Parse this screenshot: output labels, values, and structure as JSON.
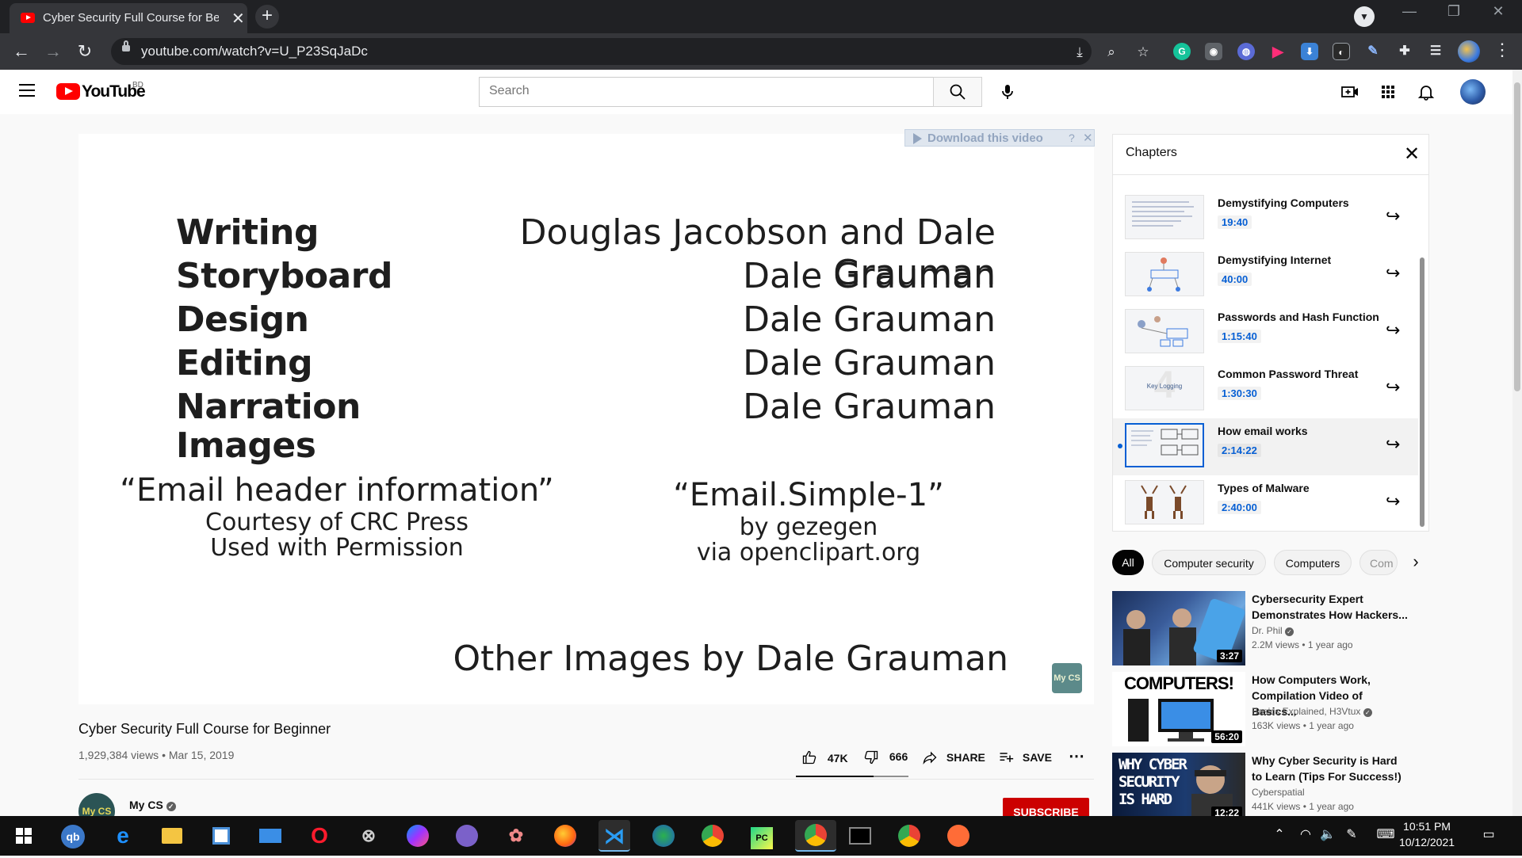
{
  "browser": {
    "tab_title": "Cyber Security Full Course for Beginner",
    "tab_close": "✕",
    "new_tab": "+",
    "url": "youtube.com/watch?v=U_P23SqJaDc",
    "win_min": "—",
    "win_max": "❐",
    "win_close": "✕"
  },
  "youtube": {
    "logo_text": "YouTube",
    "country": "BD",
    "search_placeholder": "Search"
  },
  "video": {
    "download_label": "Download this video",
    "download_help": "?",
    "download_close": "✕",
    "credits": [
      {
        "role": "Writing",
        "name": "Douglas Jacobson and Dale Grauman"
      },
      {
        "role": "Storyboard",
        "name": "Dale Grauman"
      },
      {
        "role": "Design",
        "name": "Dale Grauman"
      },
      {
        "role": "Editing",
        "name": "Dale Grauman"
      },
      {
        "role": "Narration",
        "name": "Dale Grauman"
      },
      {
        "role": "Images",
        "name": ""
      }
    ],
    "image_credit_left": {
      "title": "“Email header information”",
      "line1": "Courtesy of CRC Press",
      "line2": "Used with Permission"
    },
    "image_credit_right": {
      "title": "“Email.Simple-1”",
      "line1": "by gezegen",
      "line2": "via openclipart.org"
    },
    "other_images": "Other Images by Dale Grauman",
    "watermark": "My CS",
    "title": "Cyber Security Full Course for Beginner",
    "views": "1,929,384 views",
    "date": "Mar 15, 2019",
    "likes": "47K",
    "dislikes": "666",
    "like_ratio": 0.69,
    "share_label": "SHARE",
    "save_label": "SAVE",
    "more": "⋯",
    "channel_name": "My CS",
    "channel_avatar_text": "My CS",
    "subscribe_label": "SUBSCRIBE"
  },
  "chapters": {
    "title": "Chapters",
    "close": "✕",
    "items": [
      {
        "title": "Demystifying Computers",
        "time": "19:40"
      },
      {
        "title": "Demystifying Internet",
        "time": "40:00"
      },
      {
        "title": "Passwords and Hash Function",
        "time": "1:15:40"
      },
      {
        "title": "Common Password Threat",
        "time": "1:30:30"
      },
      {
        "title": "How email works",
        "time": "2:14:22",
        "active": true
      },
      {
        "title": "Types of Malware",
        "time": "2:40:00"
      }
    ],
    "thumb_text_password_threat": "Key Logging",
    "share_icon": "↪"
  },
  "chips": [
    "All",
    "Computer security",
    "Computers",
    "Com"
  ],
  "chips_next": "›",
  "recommendations": [
    {
      "title": "Cybersecurity Expert Demonstrates How Hackers...",
      "channel": "Dr. Phil",
      "views": "2.2M views • 1 year ago",
      "duration": "3:27"
    },
    {
      "title": "How Computers Work, Compilation Video of Basics...",
      "channel": "Basics Explained, H3Vtux",
      "views": "163K views • 1 year ago",
      "duration": "56:20",
      "thumb_text": "COMPUTERS!"
    },
    {
      "title": "Why Cyber Security is Hard to Learn (Tips For Success!)",
      "channel": "Cyberspatial",
      "views": "441K views • 1 year ago",
      "duration": "12:22",
      "thumb_text": "WHY CYBER SECURITY IS HARD"
    }
  ],
  "taskbar": {
    "time": "10:51 PM",
    "date": "10/12/2021"
  },
  "colors": {
    "yt_red": "#ff0000",
    "link_blue": "#065fd4",
    "subscribe_red": "#cc0000"
  }
}
